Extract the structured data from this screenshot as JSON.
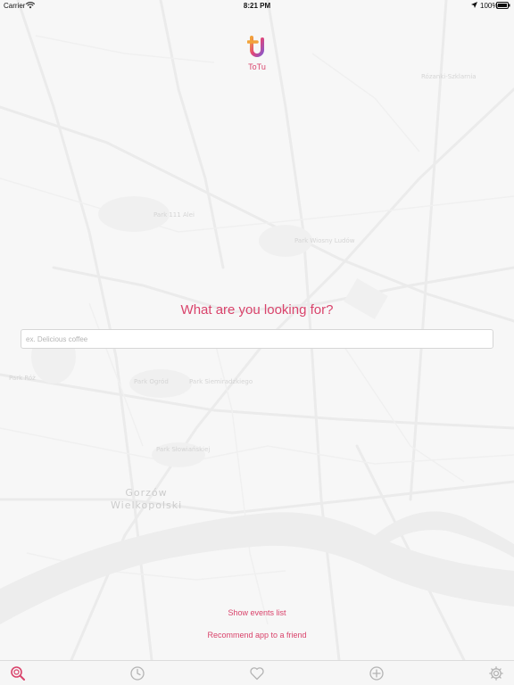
{
  "status_bar": {
    "carrier": "Carrier",
    "time": "8:21 PM",
    "battery": "100%"
  },
  "logo": {
    "text": "ToTu"
  },
  "main": {
    "question": "What are you looking for?",
    "search_placeholder": "ex. Delicious coffee",
    "search_value": ""
  },
  "links": {
    "show_events": "Show events list",
    "recommend": "Recommend app to a friend"
  },
  "map": {
    "city_name_line1": "Gorzów",
    "city_name_line2": "Wielkopolski",
    "district": "Rózanki-Szklarnia",
    "park_labels": [
      "Park 111 Alei",
      "Park Siemiradzkiego",
      "Park Ogród",
      "Park Wiosny Ludów",
      "Park Róż",
      "Park Słowiańskiej"
    ]
  },
  "tab_bar": {
    "active_color": "#d9436b",
    "inactive_color": "#b4b4b4",
    "tabs": [
      "search-icon",
      "clock-icon",
      "heart-icon",
      "plus-circle-icon",
      "gear-icon"
    ]
  },
  "colors": {
    "accent": "#d9436b",
    "logo_gradient_start": "#f2a33a",
    "logo_gradient_end": "#8a57c9"
  }
}
